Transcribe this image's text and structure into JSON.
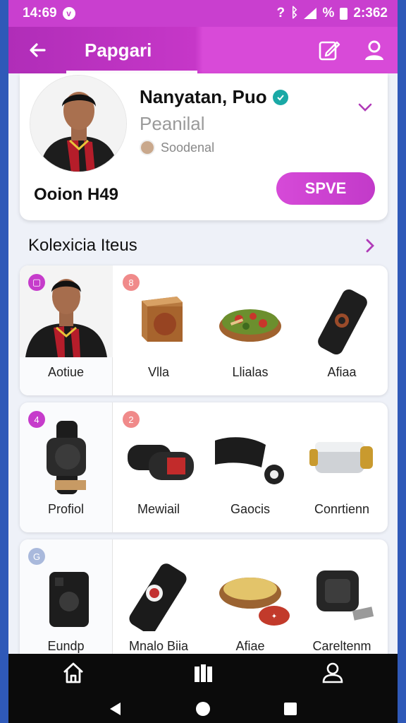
{
  "status_bar": {
    "time": "14:69",
    "percent": "%",
    "clock": "2:362"
  },
  "app_bar": {
    "title": "Papgari",
    "back_icon": "arrow-left-icon",
    "actions": [
      "edit-note-icon",
      "profile-icon"
    ]
  },
  "profile": {
    "name": "Nanyatan, Puo",
    "subtitle": "Peanilal",
    "secondary": "Soodenal",
    "footer": "Ooion H49",
    "save_label": "SPVE",
    "verified_icon": "check-badge-icon",
    "expand_icon": "chevron-down-icon"
  },
  "section": {
    "title": "Kolexicia Iteus",
    "more_icon": "chevron-right-icon"
  },
  "rows": [
    {
      "badge_left": "▢",
      "badge_right": "8",
      "items": [
        {
          "label": "Aotiue",
          "icon": "player-photo"
        },
        {
          "label": "Vlla",
          "icon": "wooden-box-icon"
        },
        {
          "label": "Llialas",
          "icon": "salad-bowl-icon"
        },
        {
          "label": "Afiaa",
          "icon": "power-bank-icon"
        }
      ]
    },
    {
      "badge_left": "4",
      "badge_right": "2",
      "items": [
        {
          "label": "Profiol",
          "icon": "smartwatch-icon"
        },
        {
          "label": "Mewiail",
          "icon": "battery-pack-icon"
        },
        {
          "label": "Gaocis",
          "icon": "strap-icon"
        },
        {
          "label": "Conrtienn",
          "icon": "metal-cylinder-icon"
        }
      ]
    },
    {
      "badge_left": "G",
      "items": [
        {
          "label": "Eundp",
          "icon": "gamepad-icon"
        },
        {
          "label": "Mnalo Biia",
          "icon": "speaker-bar-icon"
        },
        {
          "label": "Afiae",
          "icon": "pasta-bowl-icon"
        },
        {
          "label": "Careltenm",
          "icon": "sport-watch-icon"
        }
      ]
    }
  ],
  "bottom_nav": [
    "home-icon",
    "library-icon",
    "account-icon"
  ],
  "system_nav": [
    "back-triangle-icon",
    "home-circle-icon",
    "recents-square-icon"
  ],
  "colors": {
    "accent": "#c93fcf",
    "frame": "#2f59b8",
    "nav_bg": "#0b0b0b"
  }
}
